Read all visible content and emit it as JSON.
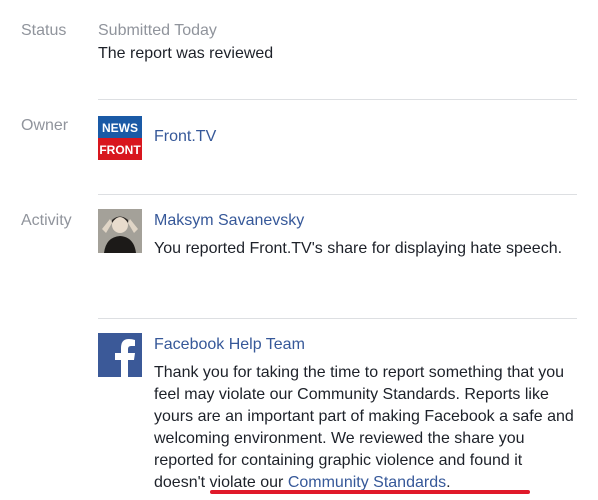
{
  "status": {
    "label": "Status",
    "submitted": "Submitted Today",
    "result": "The report was reviewed"
  },
  "owner": {
    "label": "Owner",
    "name": "Front.TV",
    "logo_text_top": "NEWS",
    "logo_text_bottom": "FRONT",
    "logo_colors": {
      "top": "#1a5aa6",
      "bottom": "#d8161e"
    }
  },
  "activity": {
    "label": "Activity",
    "entries": [
      {
        "author": "Maksym Savanevsky",
        "text": "You reported Front.TV's share for displaying hate speech.",
        "avatar": "user-photo"
      },
      {
        "author": "Facebook Help Team",
        "text_before": "Thank you for taking the time to report something that you feel may violate our Community Standards. Reports like yours are an important part of making Facebook a safe and welcoming environment. We reviewed the share you reported for containing graphic violence and found it doesn't violate our ",
        "link": "Community Standards",
        "text_after": ".",
        "avatar": "facebook-logo"
      }
    ]
  },
  "colors": {
    "link": "#365899",
    "muted": "#90949c",
    "divider": "#dddfe2",
    "highlight": "#e0192a",
    "facebook_blue": "#3b5998"
  }
}
